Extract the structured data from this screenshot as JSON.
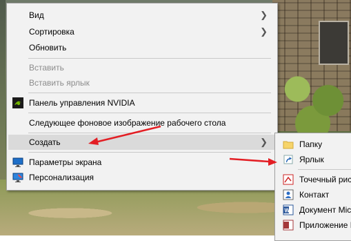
{
  "menu": {
    "view": "Вид",
    "sort": "Сортировка",
    "refresh": "Обновить",
    "paste": "Вставить",
    "paste_shortcut": "Вставить ярлык",
    "nvidia": "Панель управления NVIDIA",
    "next_background": "Следующее фоновое изображение рабочего стола",
    "create": "Создать",
    "display_settings": "Параметры экрана",
    "personalize": "Персонализация"
  },
  "submenu": {
    "folder": "Папку",
    "shortcut": "Ярлык",
    "bitmap": "Точечный рис",
    "contact": "Контакт",
    "word_doc": "Документ Mic",
    "app": "Приложение Mi"
  },
  "colors": {
    "menu_bg": "#f2f2f2",
    "hover_bg": "#dadada",
    "arrow_red": "#e31e24"
  }
}
